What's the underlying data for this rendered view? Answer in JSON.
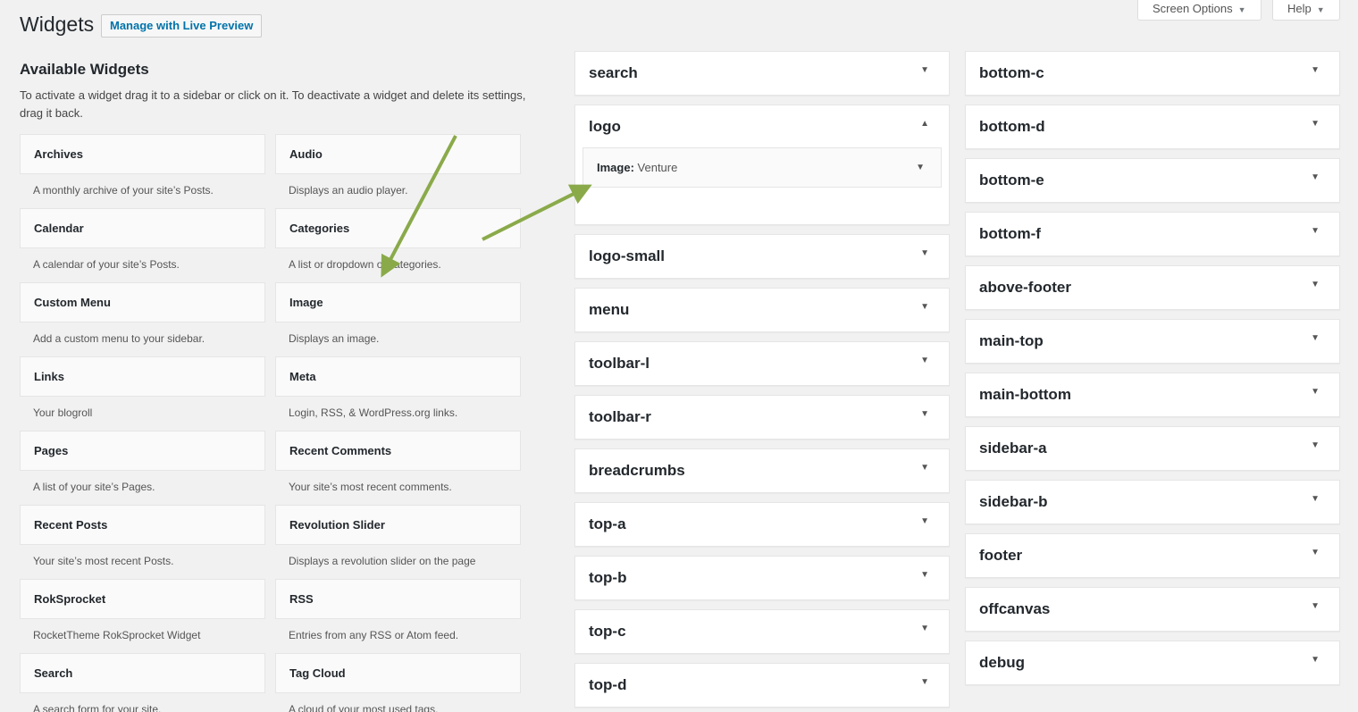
{
  "header": {
    "title": "Widgets",
    "live_preview_label": "Manage with Live Preview",
    "screen_options_label": "Screen Options",
    "help_label": "Help"
  },
  "available": {
    "title": "Available Widgets",
    "description": "To activate a widget drag it to a sidebar or click on it. To deactivate a widget and delete its settings, drag it back.",
    "widgets": [
      {
        "name": "Archives",
        "desc": "A monthly archive of your site’s Posts."
      },
      {
        "name": "Audio",
        "desc": "Displays an audio player."
      },
      {
        "name": "Calendar",
        "desc": "A calendar of your site’s Posts."
      },
      {
        "name": "Categories",
        "desc": "A list or dropdown of categories."
      },
      {
        "name": "Custom Menu",
        "desc": "Add a custom menu to your sidebar."
      },
      {
        "name": "Image",
        "desc": "Displays an image."
      },
      {
        "name": "Links",
        "desc": "Your blogroll"
      },
      {
        "name": "Meta",
        "desc": "Login, RSS, & WordPress.org links."
      },
      {
        "name": "Pages",
        "desc": "A list of your site’s Pages."
      },
      {
        "name": "Recent Comments",
        "desc": "Your site’s most recent comments."
      },
      {
        "name": "Recent Posts",
        "desc": "Your site’s most recent Posts."
      },
      {
        "name": "Revolution Slider",
        "desc": "Displays a revolution slider on the page"
      },
      {
        "name": "RokSprocket",
        "desc": "RocketTheme RokSprocket Widget"
      },
      {
        "name": "RSS",
        "desc": "Entries from any RSS or Atom feed."
      },
      {
        "name": "Search",
        "desc": "A search form for your site."
      },
      {
        "name": "Tag Cloud",
        "desc": "A cloud of your most used tags."
      }
    ]
  },
  "sidebars_col1": [
    {
      "name": "search"
    },
    {
      "name": "logo",
      "open": true,
      "inner_widget": {
        "type": "Image:",
        "title": "Venture"
      }
    },
    {
      "name": "logo-small"
    },
    {
      "name": "menu"
    },
    {
      "name": "toolbar-l"
    },
    {
      "name": "toolbar-r"
    },
    {
      "name": "breadcrumbs"
    },
    {
      "name": "top-a"
    },
    {
      "name": "top-b"
    },
    {
      "name": "top-c"
    },
    {
      "name": "top-d"
    }
  ],
  "sidebars_col2": [
    {
      "name": "bottom-c"
    },
    {
      "name": "bottom-d"
    },
    {
      "name": "bottom-e"
    },
    {
      "name": "bottom-f"
    },
    {
      "name": "above-footer"
    },
    {
      "name": "main-top"
    },
    {
      "name": "main-bottom"
    },
    {
      "name": "sidebar-a"
    },
    {
      "name": "sidebar-b"
    },
    {
      "name": "footer"
    },
    {
      "name": "offcanvas"
    },
    {
      "name": "debug"
    }
  ],
  "icons": {
    "toggle_closed": "caret-down-icon",
    "toggle_open": "caret-up-icon"
  },
  "colors": {
    "accent_link": "#0073aa",
    "annotation_arrow": "#8aaa4a",
    "page_bg": "#f1f1f1"
  }
}
